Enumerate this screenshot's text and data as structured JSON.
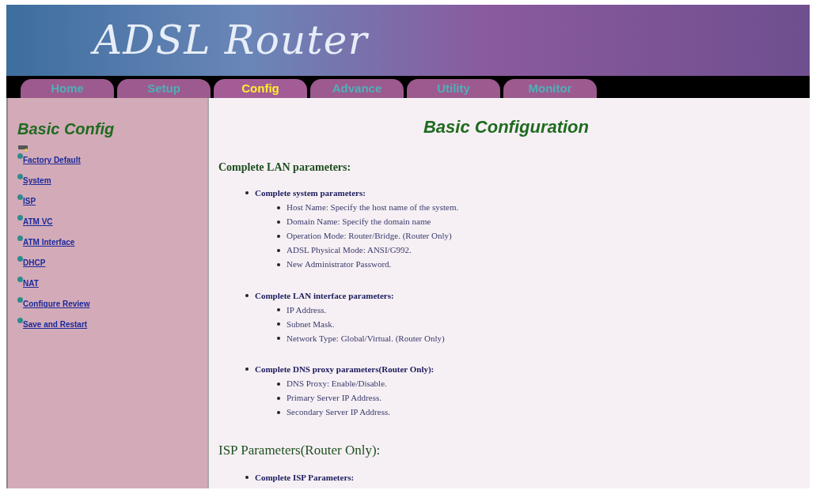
{
  "header": {
    "title": "ADSL Router"
  },
  "tabs": [
    {
      "label": "Home",
      "selected": false
    },
    {
      "label": "Setup",
      "selected": false
    },
    {
      "label": "Config",
      "selected": true
    },
    {
      "label": "Advance",
      "selected": false
    },
    {
      "label": "Utility",
      "selected": false
    },
    {
      "label": "Monitor",
      "selected": false
    }
  ],
  "sidebar": {
    "title": "Basic Config",
    "items": [
      "Factory Default",
      "System",
      "ISP",
      "ATM VC",
      "ATM Interface",
      "DHCP",
      "NAT",
      "Configure Review",
      "Save and Restart"
    ]
  },
  "content": {
    "title": "Basic Configuration",
    "sections": [
      {
        "heading": "Complete LAN parameters:",
        "groups": [
          {
            "title": "Complete system parameters:",
            "items": [
              "Host Name: Specify the host name of the system.",
              "Domain Name: Specify the domain name",
              "Operation Mode: Router/Bridge. (Router Only)",
              "ADSL Physical Mode: ANSI/G992.",
              "New Administrator Password."
            ]
          },
          {
            "title": "Complete LAN interface parameters:",
            "items": [
              "IP Address.",
              "Subnet Mask.",
              "Network Type: Global/Virtual. (Router Only)"
            ]
          },
          {
            "title": "Complete DNS proxy parameters(Router Only):",
            "items": [
              "DNS Proxy: Enable/Disable.",
              "Primary Server IP Address.",
              "Secondary Server IP Address."
            ]
          }
        ]
      },
      {
        "heading": "ISP Parameters(Router Only):",
        "groups": [
          {
            "title": "Complete ISP Parameters:"
          }
        ]
      }
    ]
  }
}
